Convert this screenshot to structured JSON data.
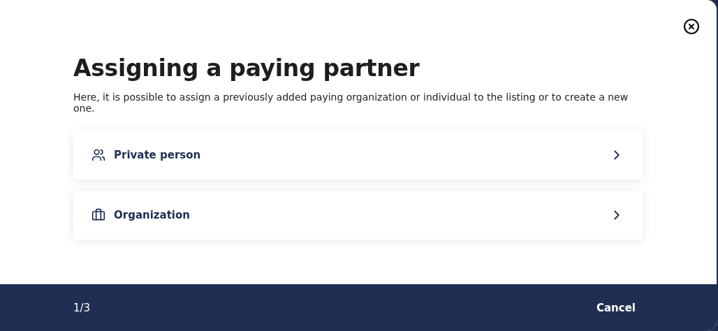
{
  "dialog": {
    "title": "Assigning a paying partner",
    "description": "Here, it is possible to assign a previously added paying organization or individual to the listing or to create a new one.",
    "options": [
      {
        "kind": "person",
        "label": "Private person"
      },
      {
        "kind": "organization",
        "label": "Organization"
      }
    ]
  },
  "footer": {
    "step": "1/3",
    "cancel": "Cancel"
  }
}
